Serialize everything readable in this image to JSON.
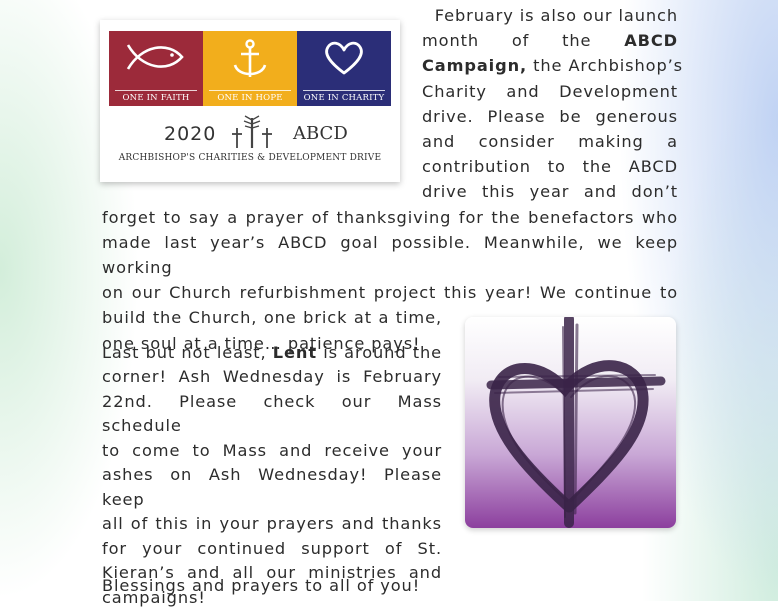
{
  "abcd_card": {
    "tiles": [
      {
        "label": "ONE IN FAITH",
        "color": "#9c2a3a",
        "icon": "fish-icon"
      },
      {
        "label": "ONE IN HOPE",
        "color": "#f2ae1c",
        "icon": "anchor-icon"
      },
      {
        "label": "ONE IN CHARITY",
        "color": "#2b2e78",
        "icon": "heart-icon"
      }
    ],
    "year": "2020",
    "acronym": "ABCD",
    "subtitle": "ARCHBISHOP'S CHARITIES & DEVELOPMENT DRIVE"
  },
  "paragraph1": {
    "line1": "February is also our launch",
    "line2": "month of the",
    "line2_bold": "ABCD",
    "line3_bold": "Campaign,",
    "line3": " the Archbishop’s",
    "line4": "Charity and Development",
    "line5": "drive. Please be generous",
    "line6": "and consider making a",
    "line7": "contribution to the ABCD",
    "line8": "drive this year and don’t",
    "line9": "forget to say a prayer of thanksgiving for the benefactors who",
    "line10": "made last year’s ABCD goal possible. Meanwhile, we keep working",
    "line11": "on our Church refurbishment project this year! We continue to",
    "line12": "build the Church, one brick at a time,",
    "line13": "one soul at a time… patience pays!"
  },
  "paragraph2": {
    "lead": "Last but not least, ",
    "bold": "Lent",
    "line1_rest": " is around the",
    "line2": "corner! Ash Wednesday is February",
    "line3": "22nd. Please check our Mass schedule",
    "line4": "to come to Mass and receive your",
    "line5": "ashes on Ash Wednesday! Please keep",
    "line6": "all of this in your prayers and thanks",
    "line7": "for your continued support of St.",
    "line8": "Kieran’s and all our ministries and",
    "line9": "campaigns!"
  },
  "closing": "Blessings and prayers to all of you!",
  "colors": {
    "purple": "#8c3f9e",
    "heart": "#3a2348"
  }
}
